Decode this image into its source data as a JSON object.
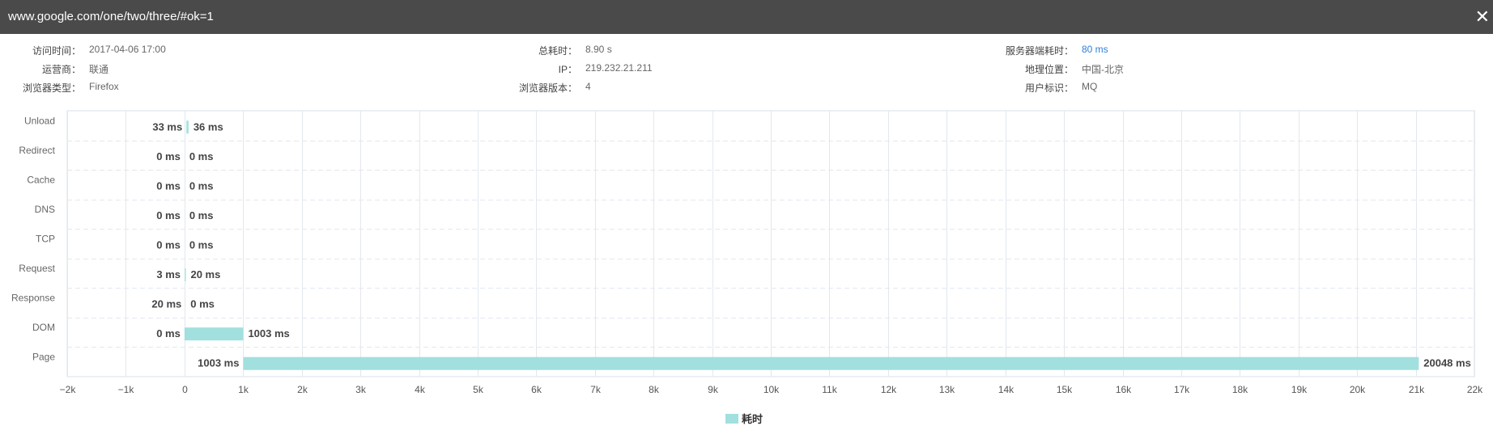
{
  "window": {
    "url": "www.google.com/one/two/three/#ok=1",
    "close_icon": "close-icon"
  },
  "info": [
    {
      "key": "visit_time",
      "label": "访问时间：",
      "value": "2017-04-06 17:00",
      "accent": false
    },
    {
      "key": "total_time",
      "label": "总耗时：",
      "value": "8.90 s",
      "accent": false
    },
    {
      "key": "server_time",
      "label": "服务器端耗时：",
      "value": "80 ms",
      "accent": true
    },
    {
      "key": "isp",
      "label": "运营商：",
      "value": "联通",
      "accent": false
    },
    {
      "key": "ip",
      "label": "IP：",
      "value": "219.232.21.211",
      "accent": false
    },
    {
      "key": "location",
      "label": "地理位置：",
      "value": "中国-北京",
      "accent": false
    },
    {
      "key": "browser_type",
      "label": "浏览器类型：",
      "value": "Firefox",
      "accent": false
    },
    {
      "key": "browser_version",
      "label": "浏览器版本：",
      "value": "4",
      "accent": false
    },
    {
      "key": "user_id",
      "label": "用户标识：",
      "value": "MQ",
      "accent": false
    }
  ],
  "chart_data": {
    "type": "bar",
    "orientation": "horizontal",
    "stacked": true,
    "categories": [
      "Unload",
      "Redirect",
      "Cache",
      "DNS",
      "TCP",
      "Request",
      "Response",
      "DOM",
      "Page"
    ],
    "series": [
      {
        "offset_ms": [
          33,
          0,
          0,
          0,
          0,
          3,
          20,
          0,
          1003
        ]
      },
      {
        "name": "耗时",
        "values_ms": [
          36,
          0,
          0,
          0,
          0,
          20,
          0,
          1003,
          20048
        ]
      }
    ],
    "offset_labels": [
      "33 ms",
      "0 ms",
      "0 ms",
      "0 ms",
      "0 ms",
      "3 ms",
      "20 ms",
      "0 ms",
      "1003 ms"
    ],
    "value_labels": [
      "36 ms",
      "0 ms",
      "0 ms",
      "0 ms",
      "0 ms",
      "20 ms",
      "0 ms",
      "1003 ms",
      "20048 ms"
    ],
    "xlim": [
      -2000,
      22000
    ],
    "xticks": [
      -2000,
      -1000,
      0,
      1000,
      2000,
      3000,
      4000,
      5000,
      6000,
      7000,
      8000,
      9000,
      10000,
      11000,
      12000,
      13000,
      14000,
      15000,
      16000,
      17000,
      18000,
      19000,
      20000,
      21000,
      22000
    ],
    "xtick_labels": [
      "−2k",
      "−1k",
      "0",
      "1k",
      "2k",
      "3k",
      "4k",
      "5k",
      "6k",
      "7k",
      "8k",
      "9k",
      "10k",
      "11k",
      "12k",
      "13k",
      "14k",
      "15k",
      "16k",
      "17k",
      "18k",
      "19k",
      "20k",
      "21k",
      "22k"
    ],
    "legend": {
      "label": "耗时",
      "position": "bottom-center"
    },
    "grid": true,
    "bar_color": "#a1e0df"
  }
}
